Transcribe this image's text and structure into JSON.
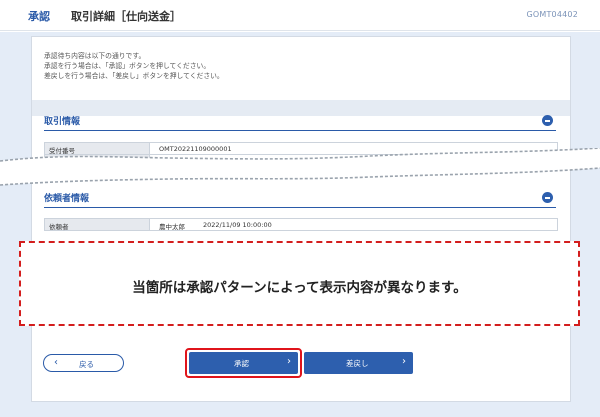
{
  "header": {
    "tab_label": "承認",
    "page_title": "取引詳細［仕向送金］",
    "screen_code": "GOMT04402"
  },
  "intro": {
    "line1": "承認待ち内容は以下の通りです。",
    "line2": "承認を行う場合は、「承認」ボタンを押してください。",
    "line3": "差戻しを行う場合は、「差戻し」ボタンを押してください。"
  },
  "transaction_info": {
    "title": "取引情報",
    "receipt_label": "受付番号",
    "receipt_value": "OMT20221109000001"
  },
  "requester_info": {
    "title": "依頼者情報",
    "requester_label": "依頼者",
    "requester_name": "農中太郎",
    "requested_at": "2022/11/09 10:00:00"
  },
  "notice": {
    "text": "当箇所は承認パターンによって表示内容が異なります。"
  },
  "buttons": {
    "back_label": "戻る",
    "approve_label": "承認",
    "reject_label": "差戻し"
  },
  "colors": {
    "accent": "#2d5fae",
    "highlight": "#e0141b",
    "background": "#e4ecf7"
  },
  "icons": {
    "collapse": "minus-circle-icon",
    "back_arrow": "chevron-left-icon",
    "forward_arrow": "chevron-right-icon"
  }
}
